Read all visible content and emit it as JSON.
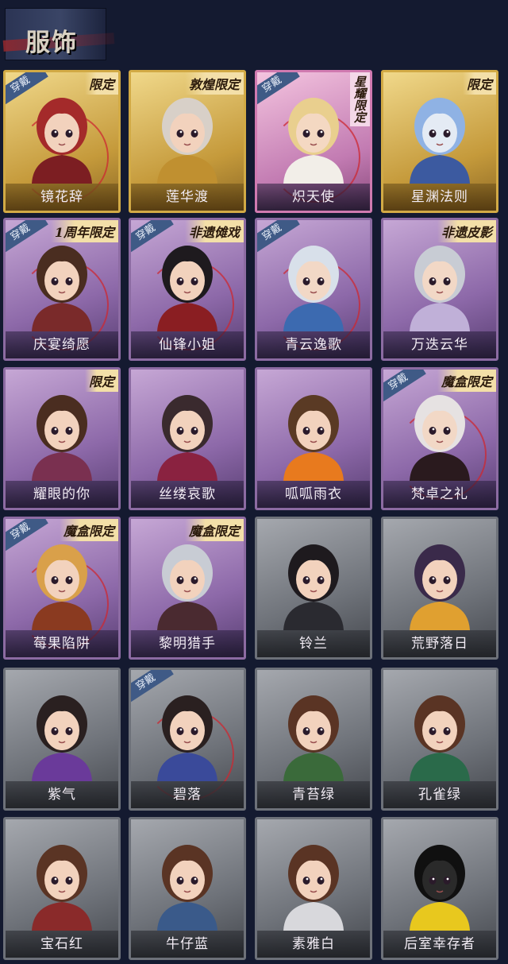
{
  "header": {
    "title": "服饰"
  },
  "icons": {
    "worn": "worn-ribbon",
    "limited": "limited-tag"
  },
  "colors": {
    "gold": "#d2aa45",
    "purple": "#8c6ba2",
    "gray": "#6d7179",
    "pink": "#d07ab0"
  },
  "costumes": [
    {
      "name": "镜花辞",
      "tier": "gold",
      "worn": "穿戴",
      "tag": "限定",
      "hair": "#a42a2a",
      "skin": "#f2d2bd",
      "outfit": "#7c1e22"
    },
    {
      "name": "莲华渡",
      "tier": "gold",
      "worn": "",
      "tag": "敦煌限定",
      "hair": "#d8d0c8",
      "skin": "#f2d2bd",
      "outfit": "#c09030"
    },
    {
      "name": "炽天使",
      "tier": "pink",
      "worn": "穿戴",
      "tag": "星耀限定",
      "hair": "#e9cf8e",
      "skin": "#f4d8c2",
      "outfit": "#f2eee8"
    },
    {
      "name": "星渊法则",
      "tier": "gold",
      "worn": "",
      "tag": "限定",
      "hair": "#8fb2e4",
      "skin": "#e4ebf4",
      "outfit": "#3c5aa0"
    },
    {
      "name": "庆宴绮愿",
      "tier": "purple",
      "worn": "穿戴",
      "tag": "1周年限定",
      "hair": "#4a2d20",
      "skin": "#f2d2bd",
      "outfit": "#7a2a2a"
    },
    {
      "name": "仙锋小姐",
      "tier": "purple",
      "worn": "穿戴",
      "tag": "非遗傩戏",
      "hair": "#1e1a1e",
      "skin": "#f2d2bd",
      "outfit": "#8a1e22"
    },
    {
      "name": "青云逸歌",
      "tier": "purple",
      "worn": "穿戴",
      "tag": "",
      "hair": "#d8e0ea",
      "skin": "#f2d8c6",
      "outfit": "#3c6ab0"
    },
    {
      "name": "万迭云华",
      "tier": "purple",
      "worn": "",
      "tag": "非遗皮影",
      "hair": "#c8ccd4",
      "skin": "#f2d8c6",
      "outfit": "#c0b0d8"
    },
    {
      "name": "耀眼的你",
      "tier": "purple",
      "worn": "",
      "tag": "限定",
      "hair": "#4a2d20",
      "skin": "#f2d2bd",
      "outfit": "#7a3050"
    },
    {
      "name": "丝缕哀歌",
      "tier": "purple",
      "worn": "",
      "tag": "",
      "hair": "#3a2a2e",
      "skin": "#f2d2bd",
      "outfit": "#8a2240"
    },
    {
      "name": "呱呱雨衣",
      "tier": "purple",
      "worn": "",
      "tag": "",
      "hair": "#5a3a24",
      "skin": "#f2d2bd",
      "outfit": "#e87a1e"
    },
    {
      "name": "梵卓之礼",
      "tier": "purple",
      "worn": "穿戴",
      "tag": "魔盒限定",
      "hair": "#e6e2e2",
      "skin": "#f2d8c6",
      "outfit": "#2a1a1e"
    },
    {
      "name": "莓果陷阱",
      "tier": "purple",
      "worn": "穿戴",
      "tag": "魔盒限定",
      "hair": "#d9a04a",
      "skin": "#f2d2bd",
      "outfit": "#8a3a20"
    },
    {
      "name": "黎明猎手",
      "tier": "purple",
      "worn": "",
      "tag": "魔盒限定",
      "hair": "#c8ccd4",
      "skin": "#f2d2bd",
      "outfit": "#4a2a30"
    },
    {
      "name": "铃兰",
      "tier": "gray",
      "worn": "",
      "tag": "",
      "hair": "#1e1a1e",
      "skin": "#f2d2bd",
      "outfit": "#2a2a30"
    },
    {
      "name": "荒野落日",
      "tier": "gray",
      "worn": "",
      "tag": "",
      "hair": "#3a2a4a",
      "skin": "#f2d2bd",
      "outfit": "#e0a030"
    },
    {
      "name": "紫气",
      "tier": "gray",
      "worn": "",
      "tag": "",
      "hair": "#2a2020",
      "skin": "#f2d2bd",
      "outfit": "#6a3a9a"
    },
    {
      "name": "碧落",
      "tier": "gray",
      "worn": "穿戴",
      "tag": "",
      "hair": "#2a2020",
      "skin": "#f2d2bd",
      "outfit": "#3a4a9a"
    },
    {
      "name": "青苔绿",
      "tier": "gray",
      "worn": "",
      "tag": "",
      "hair": "#5a3424",
      "skin": "#f2d2bd",
      "outfit": "#3a6a3a"
    },
    {
      "name": "孔雀绿",
      "tier": "gray",
      "worn": "",
      "tag": "",
      "hair": "#5a3424",
      "skin": "#f2d2bd",
      "outfit": "#2a6a4a"
    },
    {
      "name": "宝石红",
      "tier": "gray",
      "worn": "",
      "tag": "",
      "hair": "#5a3424",
      "skin": "#f2d2bd",
      "outfit": "#8a2a2a"
    },
    {
      "name": "牛仔蓝",
      "tier": "gray",
      "worn": "",
      "tag": "",
      "hair": "#5a3424",
      "skin": "#f2d2bd",
      "outfit": "#3a5a8a"
    },
    {
      "name": "素雅白",
      "tier": "gray",
      "worn": "",
      "tag": "",
      "hair": "#5a3424",
      "skin": "#f2d2bd",
      "outfit": "#d8d8dc"
    },
    {
      "name": "后室幸存者",
      "tier": "gray",
      "worn": "",
      "tag": "",
      "hair": "#101010",
      "skin": "#2a2a2a",
      "outfit": "#e8c81e"
    }
  ]
}
